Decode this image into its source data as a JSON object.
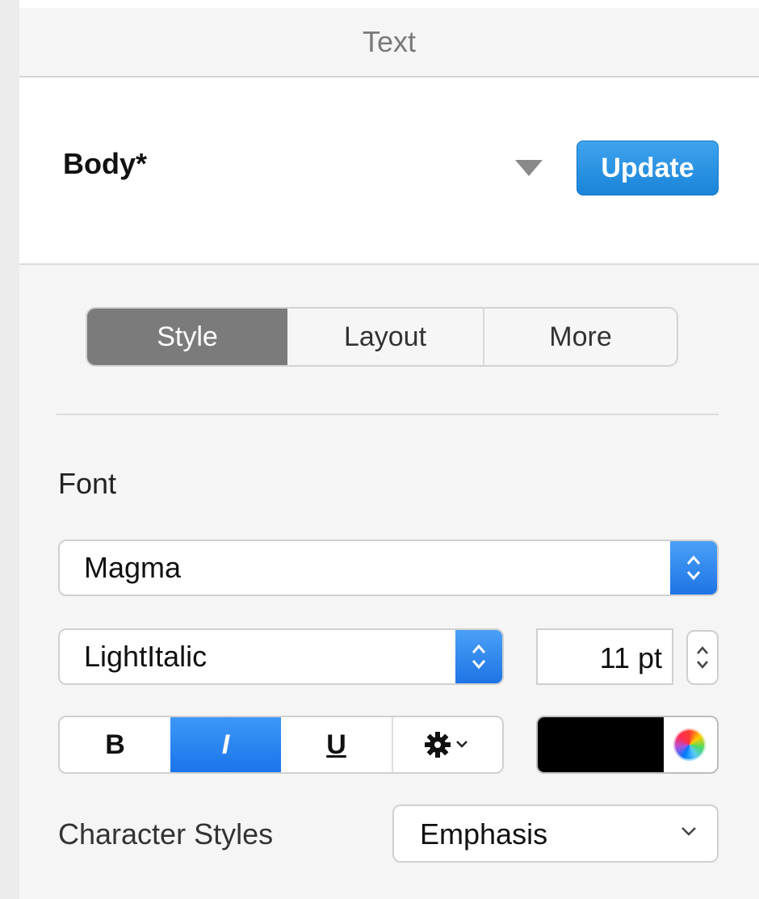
{
  "header": {
    "title": "Text"
  },
  "paragraph_style": {
    "name": "Body*",
    "update_label": "Update"
  },
  "tabs": [
    {
      "label": "Style",
      "active": true
    },
    {
      "label": "Layout",
      "active": false
    },
    {
      "label": "More",
      "active": false
    }
  ],
  "font": {
    "section_label": "Font",
    "family": "Magma",
    "typeface": "LightItalic",
    "size": "11 pt",
    "color": "#000000"
  },
  "format_buttons": [
    {
      "label": "B",
      "active": false
    },
    {
      "label": "I",
      "active": true
    },
    {
      "label": "U",
      "active": false
    }
  ],
  "character_styles": {
    "label": "Character Styles",
    "value": "Emphasis"
  },
  "colors": {
    "accent": "#1a84d8",
    "active_tab": "#7b7b7b"
  }
}
